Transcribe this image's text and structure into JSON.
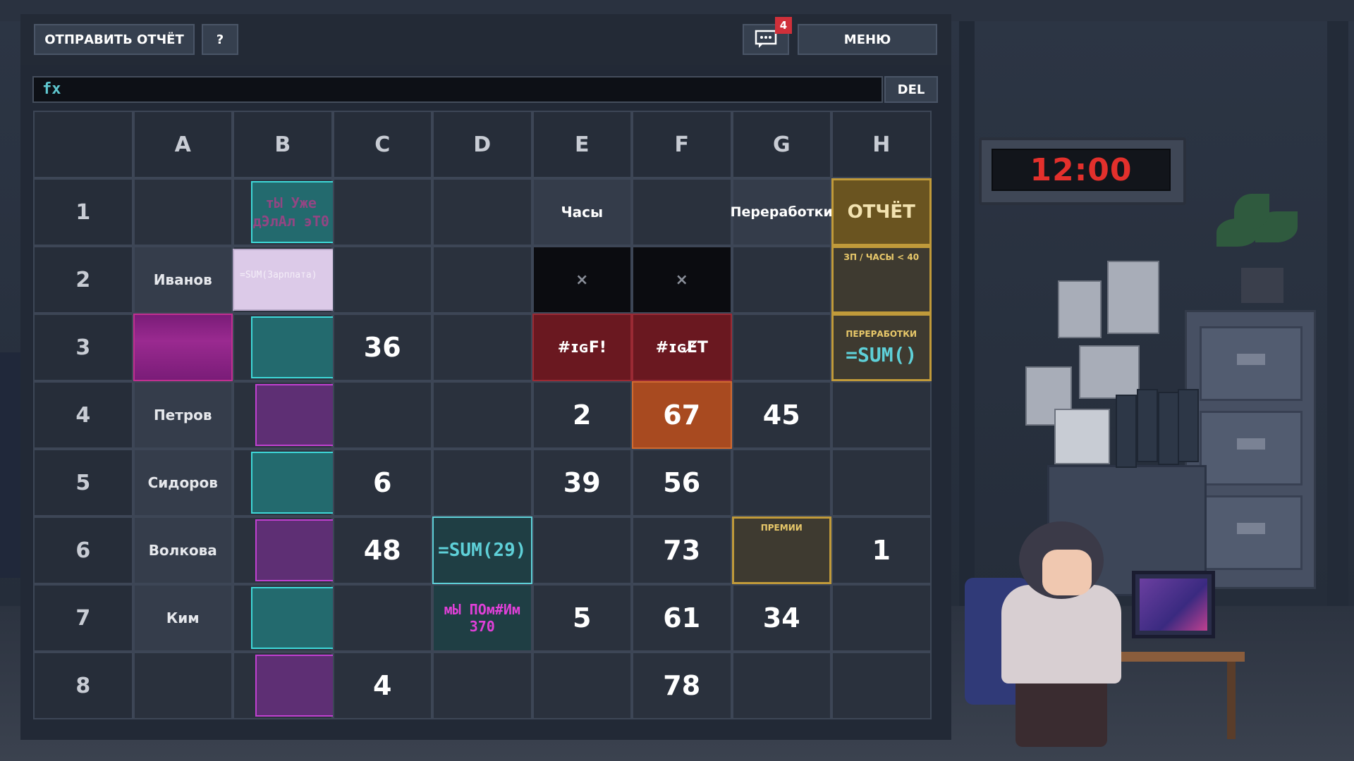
{
  "toolbar": {
    "send_report_label": "ОТПРАВИТЬ ОТЧЁТ",
    "help_label": "?",
    "chat_badge": "4",
    "menu_label": "МЕНЮ"
  },
  "formula_bar": {
    "fx_label": "fx",
    "value": "",
    "del_label": "DEL"
  },
  "clock": {
    "time": "12:00"
  },
  "sheet": {
    "columns": [
      "A",
      "B",
      "C",
      "D",
      "E",
      "F",
      "G",
      "H"
    ],
    "rows": [
      "1",
      "2",
      "3",
      "4",
      "5",
      "6",
      "7",
      "8"
    ],
    "r1": {
      "b": "тЫ Уже дЭлАл эТ0",
      "e": "Часы",
      "g": "Переработки",
      "h": "ОТЧЁТ"
    },
    "r2": {
      "a": "Иванов",
      "b": "=SUM(Зарплата)",
      "e": "×",
      "f": "×",
      "h": "ЗП / ЧАСЫ < 40"
    },
    "r3": {
      "c": "36",
      "e": "#ɪɢF!",
      "f": "#ɪɢE̸T",
      "h_title": "ПЕРЕРАБОТКИ",
      "h_formula": "=SUM()"
    },
    "r4": {
      "a": "Петров",
      "e": "2",
      "f": "67",
      "g": "45"
    },
    "r5": {
      "a": "Сидоров",
      "c": "6",
      "e": "39",
      "f": "56"
    },
    "r6": {
      "a": "Волкова",
      "c": "48",
      "d": "=SUM(29)",
      "f": "73",
      "g": "ПРЕМИИ",
      "h": "1"
    },
    "r7": {
      "a": "Ким",
      "d": "мЫ ПОм#Им 370",
      "e": "5",
      "f": "61",
      "g": "34"
    },
    "r8": {
      "c": "4",
      "f": "78"
    }
  },
  "colors": {
    "accent_teal": "#5ed0d8",
    "error_red": "#6a1820",
    "report_gold": "#c09a3a",
    "glitch_magenta": "#e040d8",
    "clock_red": "#e3302c"
  }
}
